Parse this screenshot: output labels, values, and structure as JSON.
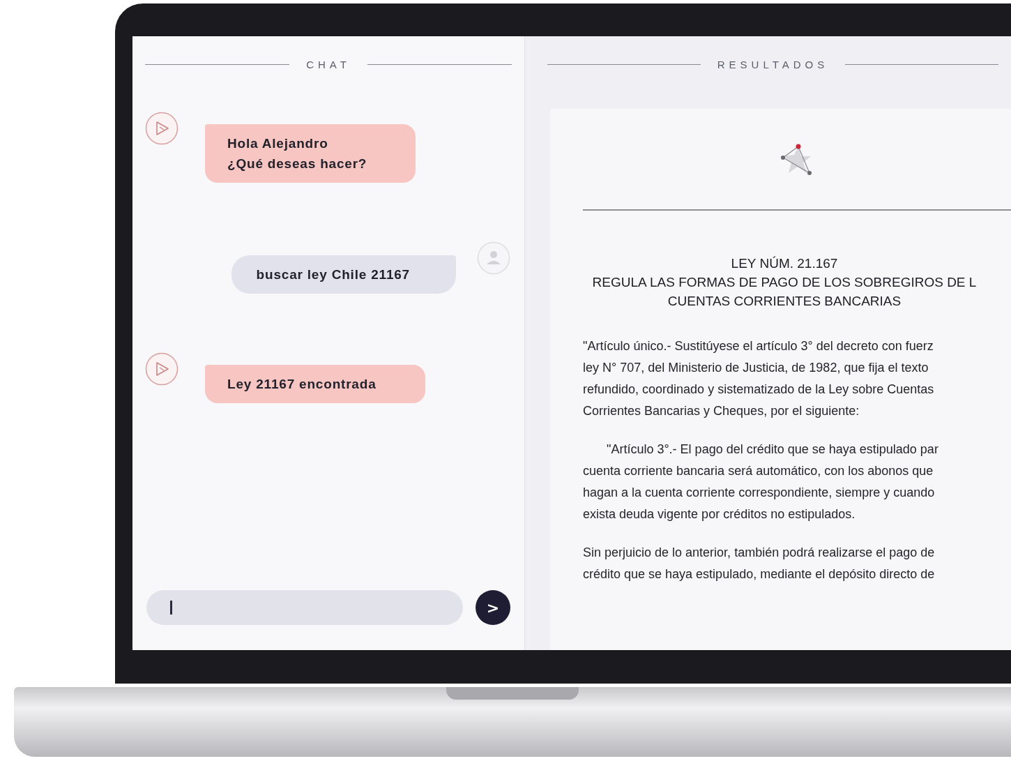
{
  "chat": {
    "title": "CHAT",
    "messages": [
      {
        "kind": "bot",
        "lines": [
          "Hola Alejandro",
          "¿Qué deseas hacer?"
        ]
      },
      {
        "kind": "user",
        "lines": [
          "buscar ley Chile 21167"
        ]
      },
      {
        "kind": "bot",
        "lines": [
          "Ley 21167 encontrada"
        ]
      }
    ],
    "send_label": ">"
  },
  "results": {
    "title": "RESULTADOS",
    "document": {
      "heading": [
        "LEY NÚM. 21.167",
        "REGULA LAS FORMAS DE PAGO DE LOS SOBREGIROS DE L",
        "CUENTAS CORRIENTES BANCARIAS"
      ],
      "paragraphs": [
        {
          "indent": false,
          "lines": [
            "\"Artículo único.- Sustitúyese el artículo 3° del decreto con fuerz",
            "ley N° 707, del Ministerio de Justicia, de 1982, que fija el texto",
            "refundido, coordinado y sistematizado de la Ley sobre Cuentas",
            "Corrientes Bancarias y Cheques, por el siguiente:"
          ]
        },
        {
          "indent": true,
          "lines": [
            "\"Artículo 3°.- El pago del crédito que se haya estipulado par",
            "cuenta corriente bancaria será automático, con los abonos que",
            "hagan a la cuenta corriente correspondiente, siempre y cuando",
            "exista deuda vigente por créditos no estipulados."
          ]
        },
        {
          "indent": false,
          "lines": [
            "Sin perjuicio de lo anterior, también podrá realizarse el pago de",
            "crédito que se haya estipulado, mediante el depósito directo de"
          ]
        }
      ]
    }
  }
}
